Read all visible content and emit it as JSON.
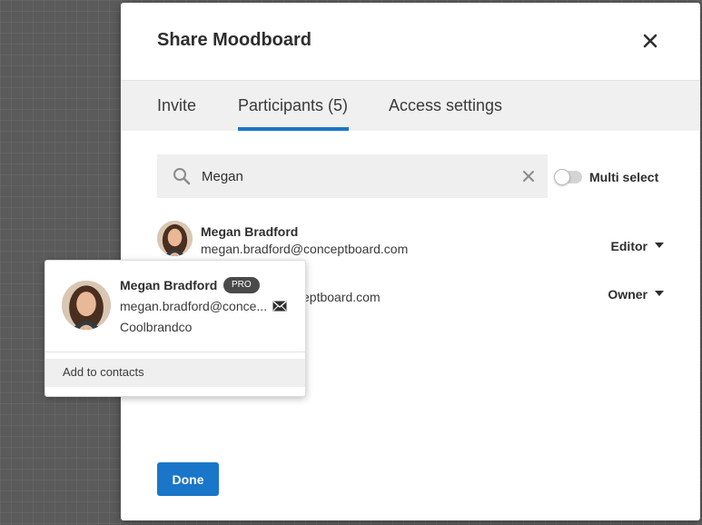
{
  "modal": {
    "title": "Share Moodboard",
    "close_icon": "close-icon"
  },
  "tabs": [
    {
      "label": "Invite",
      "active": false
    },
    {
      "label": "Participants (5)",
      "active": true
    },
    {
      "label": "Access settings",
      "active": false
    }
  ],
  "colors": {
    "accent": "#1976c8",
    "backdrop": "#5b5b5b",
    "badge": "#4a4a4a"
  },
  "search": {
    "value": "Megan",
    "icon": "search-icon",
    "clear_icon": "clear-icon"
  },
  "multi_select": {
    "label": "Multi select",
    "enabled": false
  },
  "participants": [
    {
      "name": "Megan Bradford",
      "email": "megan.bradford@conceptboard.com",
      "role": "Editor"
    },
    {
      "email_visible_part": "eptboard.com",
      "role": "Owner"
    }
  ],
  "done_label": "Done",
  "popover": {
    "name": "Megan Bradford",
    "badge": "PRO",
    "email": "megan.bradford@conce...",
    "mail_icon": "envelope-icon",
    "company": "Coolbrandco",
    "action": "Add to contacts"
  }
}
